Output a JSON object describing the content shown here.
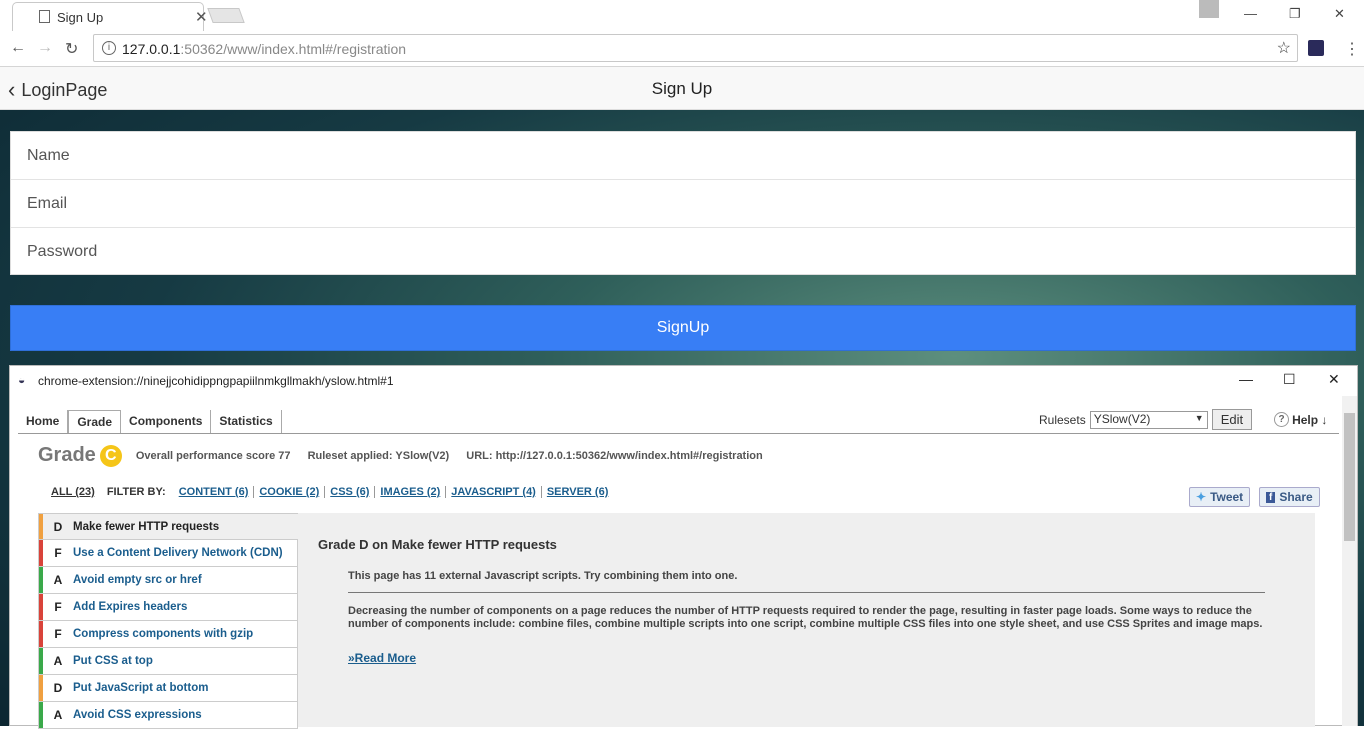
{
  "browser": {
    "tab_title": "Sign Up",
    "url_host": "127.0.0.1",
    "url_rest": ":50362/www/index.html#/registration"
  },
  "app": {
    "back_label": "LoginPage",
    "title": "Sign Up",
    "fields": {
      "name": "Name",
      "email": "Email",
      "password": "Password"
    },
    "signup_label": "SignUp"
  },
  "yslow": {
    "window_title": "chrome-extension://ninejjcohidippngpapiilnmkgllmakh/yslow.html#1",
    "nav_tabs": [
      "Home",
      "Grade",
      "Components",
      "Statistics"
    ],
    "rulesets_label": "Rulesets",
    "ruleset_value": "YSlow(V2)",
    "edit_label": "Edit",
    "help_label": "Help ↓",
    "grade_label": "Grade",
    "grade_letter": "C",
    "score_text": "Overall performance score 77",
    "ruleset_applied": "Ruleset applied: YSlow(V2)",
    "url_text": "URL: http://127.0.0.1:50362/www/index.html#/registration",
    "filter_all": "ALL (23)",
    "filter_by": "FILTER BY:",
    "filters": [
      "CONTENT (6)",
      "COOKIE (2)",
      "CSS (6)",
      "IMAGES (2)",
      "JAVASCRIPT (4)",
      "SERVER (6)"
    ],
    "tweet": "Tweet",
    "share": "Share",
    "rules": [
      {
        "grade": "D",
        "name": "Make fewer HTTP requests",
        "color": "#f0a040"
      },
      {
        "grade": "F",
        "name": "Use a Content Delivery Network (CDN)",
        "color": "#d9433a"
      },
      {
        "grade": "A",
        "name": "Avoid empty src or href",
        "color": "#3aa94a"
      },
      {
        "grade": "F",
        "name": "Add Expires headers",
        "color": "#d9433a"
      },
      {
        "grade": "F",
        "name": "Compress components with gzip",
        "color": "#d9433a"
      },
      {
        "grade": "A",
        "name": "Put CSS at top",
        "color": "#3aa94a"
      },
      {
        "grade": "D",
        "name": "Put JavaScript at bottom",
        "color": "#f0a040"
      },
      {
        "grade": "A",
        "name": "Avoid CSS expressions",
        "color": "#3aa94a"
      }
    ],
    "detail": {
      "heading": "Grade D on Make fewer HTTP requests",
      "p1": "This page has 11 external Javascript scripts. Try combining them into one.",
      "p2": "Decreasing the number of components on a page reduces the number of HTTP requests required to render the page, resulting in faster page loads. Some ways to reduce the number of components include: combine files, combine multiple scripts into one script, combine multiple CSS files into one style sheet, and use CSS Sprites and image maps.",
      "read_more": "»Read More"
    }
  }
}
